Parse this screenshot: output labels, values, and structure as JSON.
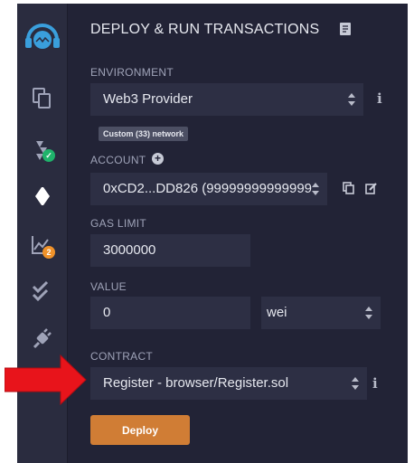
{
  "panel": {
    "title": "DEPLOY & RUN TRANSACTIONS",
    "environment": {
      "label": "ENVIRONMENT",
      "value": "Web3 Provider",
      "network_badge": "Custom (33) network"
    },
    "account": {
      "label": "ACCOUNT",
      "value": "0xCD2...DD826 (99999999999999"
    },
    "gas_limit": {
      "label": "GAS LIMIT",
      "value": "3000000"
    },
    "value": {
      "label": "VALUE",
      "amount": "0",
      "unit": "wei"
    },
    "contract": {
      "label": "CONTRACT",
      "value": "Register - browser/Register.sol"
    },
    "deploy_label": "Deploy"
  },
  "iconbar": {
    "icons": [
      "remix-logo-icon",
      "file-explorer-icon",
      "compiler-icon",
      "deploy-run-icon",
      "analysis-icon",
      "verification-icon",
      "plugin-icon"
    ],
    "analysis_badge": "2"
  },
  "colors": {
    "background": "#222336",
    "field": "#2d2f44",
    "accent": "#d07d35",
    "arrow": "#e8141b",
    "success": "#1fb36b",
    "warning": "#f0922a"
  }
}
